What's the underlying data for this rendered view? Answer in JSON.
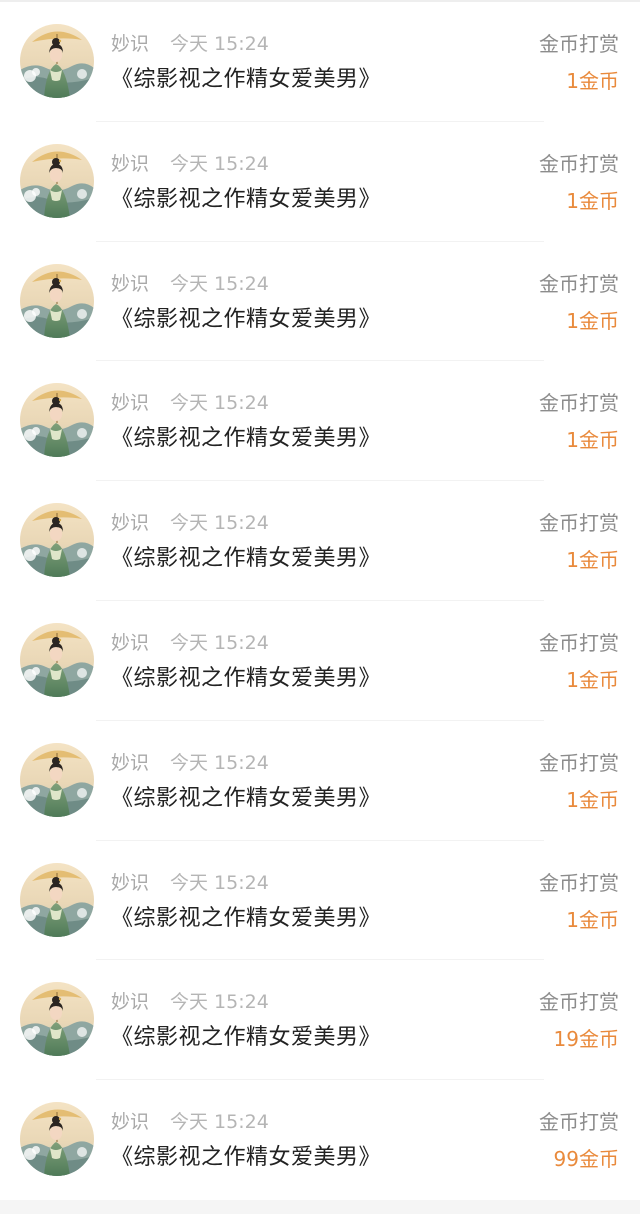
{
  "colors": {
    "name": "#a9a9a9",
    "time": "#b5b5b5",
    "title": "#222222",
    "action": "#8c8c8c",
    "amount": "#e98a3c",
    "divider": "#f2f2f2"
  },
  "records": [
    {
      "user": "妙识",
      "time": "今天 15:24",
      "book": "《综影视之作精女爱美男》",
      "action": "金币打赏",
      "amount": "1金币"
    },
    {
      "user": "妙识",
      "time": "今天 15:24",
      "book": "《综影视之作精女爱美男》",
      "action": "金币打赏",
      "amount": "1金币"
    },
    {
      "user": "妙识",
      "time": "今天 15:24",
      "book": "《综影视之作精女爱美男》",
      "action": "金币打赏",
      "amount": "1金币"
    },
    {
      "user": "妙识",
      "time": "今天 15:24",
      "book": "《综影视之作精女爱美男》",
      "action": "金币打赏",
      "amount": "1金币"
    },
    {
      "user": "妙识",
      "time": "今天 15:24",
      "book": "《综影视之作精女爱美男》",
      "action": "金币打赏",
      "amount": "1金币"
    },
    {
      "user": "妙识",
      "time": "今天 15:24",
      "book": "《综影视之作精女爱美男》",
      "action": "金币打赏",
      "amount": "1金币"
    },
    {
      "user": "妙识",
      "time": "今天 15:24",
      "book": "《综影视之作精女爱美男》",
      "action": "金币打赏",
      "amount": "1金币"
    },
    {
      "user": "妙识",
      "time": "今天 15:24",
      "book": "《综影视之作精女爱美男》",
      "action": "金币打赏",
      "amount": "1金币"
    },
    {
      "user": "妙识",
      "time": "今天 15:24",
      "book": "《综影视之作精女爱美男》",
      "action": "金币打赏",
      "amount": "19金币"
    },
    {
      "user": "妙识",
      "time": "今天 15:24",
      "book": "《综影视之作精女爱美男》",
      "action": "金币打赏",
      "amount": "99金币"
    }
  ]
}
